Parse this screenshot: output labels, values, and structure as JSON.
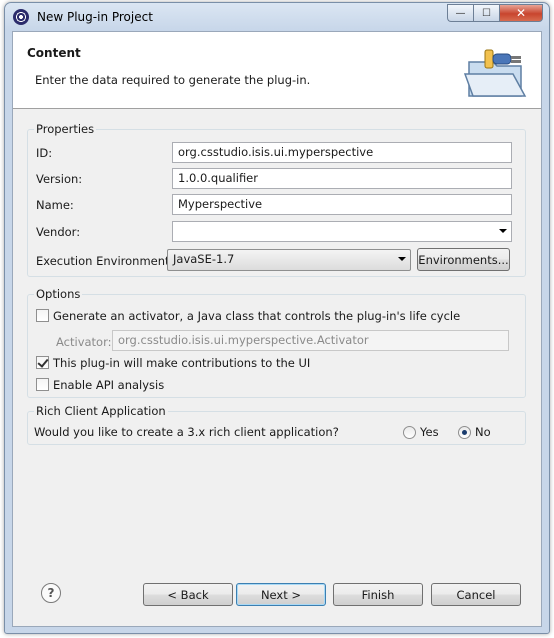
{
  "window": {
    "title": "New Plug-in Project",
    "controls": {
      "minimize": "—",
      "maximize": "☐",
      "close": "✕"
    }
  },
  "header": {
    "title": "Content",
    "description": "Enter the data required to generate the plug-in."
  },
  "properties": {
    "group_label": "Properties",
    "id_label": "ID:",
    "id_value": "org.csstudio.isis.ui.myperspective",
    "version_label": "Version:",
    "version_value": "1.0.0.qualifier",
    "name_label": "Name:",
    "name_value": "Myperspective",
    "vendor_label": "Vendor:",
    "vendor_value": "",
    "exec_env_label": "Execution Environment:",
    "exec_env_value": "JavaSE-1.7",
    "environments_button": "Environments..."
  },
  "options": {
    "group_label": "Options",
    "generate_activator_label": "Generate an activator, a Java class that controls the plug-in's life cycle",
    "generate_activator_checked": false,
    "activator_label": "Activator:",
    "activator_value": "org.csstudio.isis.ui.myperspective.Activator",
    "ui_contrib_label": "This plug-in will make contributions to the UI",
    "ui_contrib_checked": true,
    "api_analysis_label": "Enable API analysis",
    "api_analysis_checked": false
  },
  "rca": {
    "group_label": "Rich Client Application",
    "question": "Would you like to create a 3.x rich client application?",
    "yes_label": "Yes",
    "no_label": "No",
    "selected": "No"
  },
  "footer": {
    "help_symbol": "?",
    "back_button": "< Back",
    "next_button": "Next >",
    "finish_button": "Finish",
    "cancel_button": "Cancel"
  },
  "icons": {
    "app_icon": "eclipse-icon",
    "header_image": "plugin-folder-icon",
    "help": "help-icon"
  }
}
